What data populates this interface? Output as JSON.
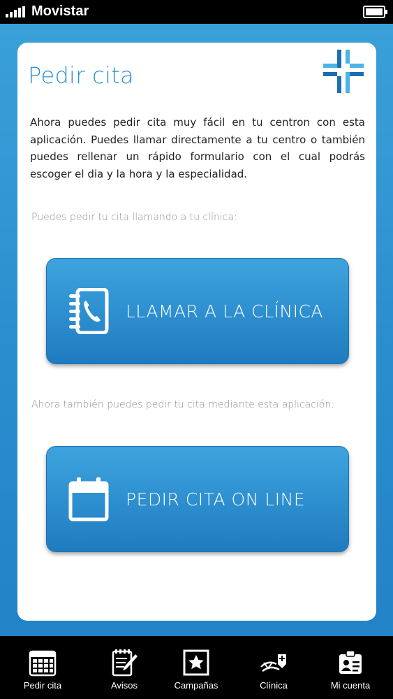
{
  "status": {
    "carrier": "Movistar",
    "signal_icon": "signal-bars-icon",
    "battery_icon": "battery-icon"
  },
  "page": {
    "title": "Pedir cita",
    "logo_icon": "medical-cross-logo",
    "intro": "Ahora puedes pedir cita muy fácil en tu centron con esta aplicación. Puedes llamar directamente a tu centro o también puedes rellenar un rápido formulario con el cual podrás escoger el dia y la hora y la especialidad.",
    "call_hint": "Puedes pedir tu cita llamando a tu clínica:",
    "call_button": "LLAMAR A LA CLÍNICA",
    "call_icon": "phone-book-icon",
    "online_hint": "Ahora también puedes pedir tu cita mediante esta aplicación:",
    "online_button": "PEDIR CITA ON LINE",
    "online_icon": "calendar-icon"
  },
  "tabs": [
    {
      "label": "Pedir cita",
      "icon": "calendar-grid-icon"
    },
    {
      "label": "Avisos",
      "icon": "notepad-pencil-icon"
    },
    {
      "label": "Campañas",
      "icon": "star-frame-icon"
    },
    {
      "label": "Clínica",
      "icon": "clinic-icon"
    },
    {
      "label": "Mi cuenta",
      "icon": "id-badge-icon"
    }
  ],
  "colors": {
    "accent": "#2b8fcf",
    "background": "#2283c6",
    "button": "#2e90d0",
    "logo_dark": "#1b6fb0",
    "logo_light": "#4cb3e6"
  }
}
